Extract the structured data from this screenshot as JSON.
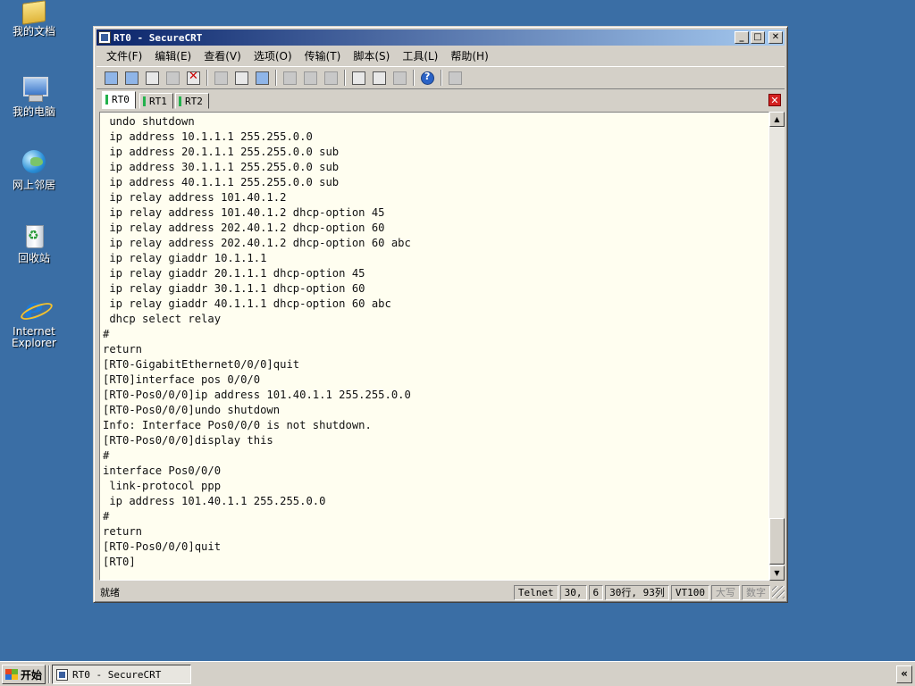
{
  "desktop": {
    "icons": [
      {
        "label": "我的文档",
        "icon": "my-documents-icon"
      },
      {
        "label": "我的电脑",
        "icon": "my-computer-icon"
      },
      {
        "label": "网上邻居",
        "icon": "network-places-icon"
      },
      {
        "label": "回收站",
        "icon": "recycle-bin-icon"
      },
      {
        "label": "Internet\nExplorer",
        "icon": "internet-explorer-icon"
      }
    ]
  },
  "window": {
    "title": "RT0 - SecureCRT",
    "controls": {
      "minimize": "_",
      "maximize": "□",
      "close": "✕"
    }
  },
  "menu": [
    "文件(F)",
    "编辑(E)",
    "查看(V)",
    "选项(O)",
    "传输(T)",
    "脚本(S)",
    "工具(L)",
    "帮助(H)"
  ],
  "tabs": [
    "RT0",
    "RT1",
    "RT2"
  ],
  "active_tab": "RT0",
  "terminal_lines": [
    " undo shutdown",
    " ip address 10.1.1.1 255.255.0.0",
    " ip address 20.1.1.1 255.255.0.0 sub",
    " ip address 30.1.1.1 255.255.0.0 sub",
    " ip address 40.1.1.1 255.255.0.0 sub",
    " ip relay address 101.40.1.2",
    " ip relay address 101.40.1.2 dhcp-option 45",
    " ip relay address 202.40.1.2 dhcp-option 60",
    " ip relay address 202.40.1.2 dhcp-option 60 abc",
    " ip relay giaddr 10.1.1.1",
    " ip relay giaddr 20.1.1.1 dhcp-option 45",
    " ip relay giaddr 30.1.1.1 dhcp-option 60",
    " ip relay giaddr 40.1.1.1 dhcp-option 60 abc",
    " dhcp select relay",
    "#",
    "return",
    "[RT0-GigabitEthernet0/0/0]quit",
    "[RT0]interface pos 0/0/0",
    "[RT0-Pos0/0/0]ip address 101.40.1.1 255.255.0.0",
    "[RT0-Pos0/0/0]undo shutdown",
    "Info: Interface Pos0/0/0 is not shutdown.",
    "[RT0-Pos0/0/0]display this",
    "#",
    "interface Pos0/0/0",
    " link-protocol ppp",
    " ip address 101.40.1.1 255.255.0.0",
    "#",
    "return",
    "[RT0-Pos0/0/0]quit",
    "[RT0]"
  ],
  "status": {
    "ready": "就绪",
    "protocol": "Telnet",
    "cursor_row": "30,",
    "cursor_col": "6",
    "size": "30行, 93列",
    "terminal": "VT100",
    "caps": "大写",
    "num": "数字"
  },
  "taskbar": {
    "start": "开始",
    "task": "RT0 - SecureCRT",
    "tray_toggle": "«"
  }
}
